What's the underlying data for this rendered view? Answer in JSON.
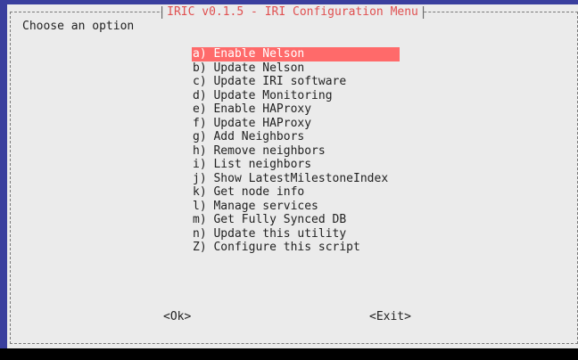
{
  "dialog": {
    "title": "IRIC v0.1.5 - IRI Configuration Menu",
    "prompt": "Choose an option"
  },
  "menu": {
    "items": [
      "a) Enable Nelson",
      "b) Update Nelson",
      "c) Update IRI software",
      "d) Update Monitoring",
      "e) Enable HAProxy",
      "f) Update HAProxy",
      "g) Add Neighbors",
      "h) Remove neighbors",
      "i) List neighbors",
      "j) Show LatestMilestoneIndex",
      "k) Get node info",
      "l) Manage services",
      "m) Get Fully Synced DB",
      "n) Update this utility",
      "Z) Configure this script"
    ]
  },
  "buttons": {
    "ok": "<Ok>",
    "exit": "<Exit>"
  },
  "colors": {
    "background": "#3a3f9e",
    "dialog": "#ebebeb",
    "highlight": "#ff6a6a",
    "title": "#e05050"
  }
}
